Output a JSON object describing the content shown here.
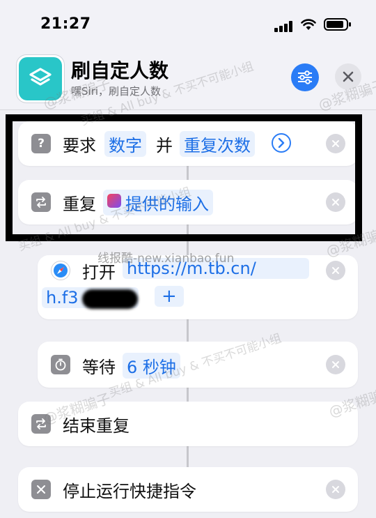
{
  "status_bar": {
    "time": "21:27"
  },
  "header": {
    "title": "刷自定人数",
    "subtitle": "嘿Siri，刷自定人数"
  },
  "actions": {
    "ask": {
      "label": "要求",
      "token_type": "数字",
      "conjunction": "并",
      "token_target": "重复次数"
    },
    "repeat": {
      "label": "重复",
      "token": "提供的输入"
    },
    "open": {
      "label": "打开",
      "url_line1": "https://m.tb.cn/",
      "url_line2": "h.f3",
      "add_symbol": "+"
    },
    "wait": {
      "label": "等待",
      "token": "6 秒钟"
    },
    "end_repeat": {
      "label": "结束重复"
    },
    "stop": {
      "label": "停止运行快捷指令"
    }
  },
  "watermarks": {
    "text1": "买组 & All buy & 不买不可能小组",
    "text2": "@浆糊骗子",
    "text3": "线报酷-new.xianbao.fun"
  },
  "colors": {
    "accent": "#2a7cf6",
    "app_icon": "#29c6c8",
    "token_text": "#1d6fe6",
    "token_bg": "#e9f1fd"
  }
}
